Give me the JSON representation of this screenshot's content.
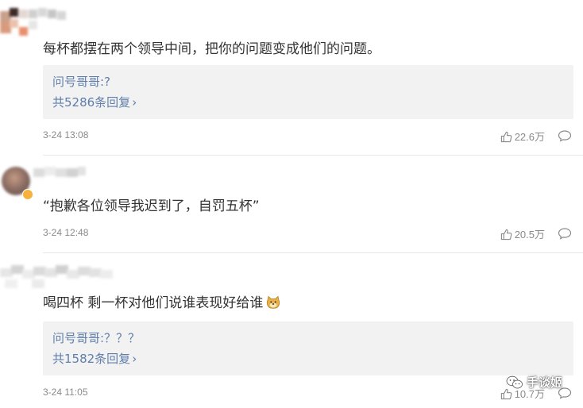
{
  "comments": [
    {
      "text": "每杯都摆在两个领导中间，把你的问题变成他们的问题。",
      "reply_preview": "问号哥哥:?",
      "reply_count": "共5286条回复",
      "time": "3-24 13:08",
      "likes": "22.6万"
    },
    {
      "text": "“抱歉各位领导我迟到了，自罚五杯”",
      "time": "3-24 12:48",
      "likes": "20.5万"
    },
    {
      "text": "喝四杯 剩一杯对他们说谁表现好给谁",
      "reply_preview": "问号哥哥:？？？",
      "reply_count": "共1582条回复",
      "time": "3-24 11:05",
      "likes": "10.7万"
    }
  ],
  "watermark": "手谈姬",
  "icons": {
    "like": "thumbs-up-icon",
    "comment": "comment-bubble-icon",
    "emoji": "doge-emoji-icon",
    "watermark": "wechat-icon"
  },
  "colors": {
    "link": "#5f7eab",
    "meta": "#8a8a8a",
    "reply_bg": "#f2f2f2"
  }
}
